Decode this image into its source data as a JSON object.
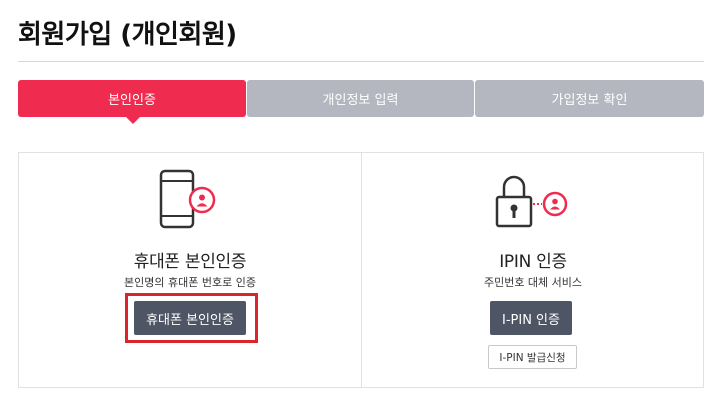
{
  "page": {
    "title": "회원가입 (개인회원)"
  },
  "steps": [
    {
      "label": "본인인증",
      "active": true
    },
    {
      "label": "개인정보 입력",
      "active": false
    },
    {
      "label": "가입정보 확인",
      "active": false
    }
  ],
  "phone_auth": {
    "title": "휴대폰 본인인증",
    "description": "본인명의 휴대폰 번호로 인증",
    "button_label": "휴대폰 본인인증"
  },
  "ipin_auth": {
    "title": "IPIN 인증",
    "description": "주민번호 대체 서비스",
    "button_label": "I-PIN 인증",
    "issue_button_label": "I-PIN 발급신청"
  },
  "colors": {
    "accent": "#ef2b4f",
    "step_inactive": "#b4b6c0",
    "button_dark": "#4e5564",
    "highlight": "#d9252b"
  },
  "icons": {
    "phone": "smartphone-user-icon",
    "ipin": "padlock-user-icon"
  }
}
